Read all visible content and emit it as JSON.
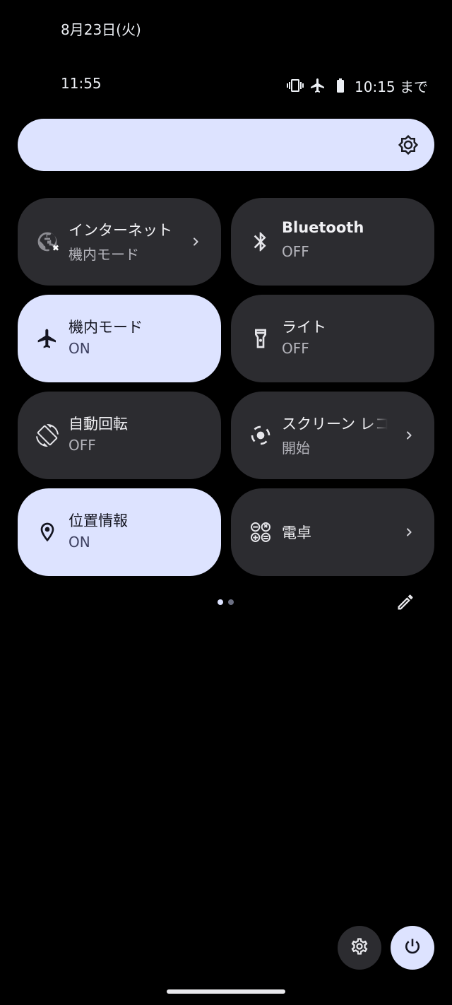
{
  "status": {
    "date": "8月23日(火)",
    "clock": "11:55",
    "battery_text": "10:15 まで",
    "icons": [
      "vibrate-icon",
      "airplane-icon",
      "battery-icon"
    ]
  },
  "brightness": {
    "icon": "brightness-icon"
  },
  "tiles": [
    {
      "label": "インターネット",
      "sub": "機内モード",
      "state": "unavailable",
      "icon": "globe-off-icon",
      "chevron": true
    },
    {
      "label": "Bluetooth",
      "sub": "OFF",
      "state": "off",
      "icon": "bluetooth-icon",
      "chevron": false
    },
    {
      "label": "機内モード",
      "sub": "ON",
      "state": "on",
      "icon": "airplane-icon",
      "chevron": false
    },
    {
      "label": "ライト",
      "sub": "OFF",
      "state": "off",
      "icon": "flashlight-icon",
      "chevron": false
    },
    {
      "label": "自動回転",
      "sub": "OFF",
      "state": "off",
      "icon": "auto-rotate-icon",
      "chevron": false
    },
    {
      "label": "スクリーン レコード",
      "sub": "開始",
      "state": "off",
      "icon": "screen-record-icon",
      "chevron": true
    },
    {
      "label": "位置情報",
      "sub": "ON",
      "state": "on",
      "icon": "location-icon",
      "chevron": false
    },
    {
      "label": "電卓",
      "sub": "",
      "state": "off",
      "icon": "calculator-icon",
      "chevron": true
    }
  ],
  "pager": {
    "pages": 2,
    "current": 1
  },
  "colors": {
    "background": "#000000",
    "tile_off": "#2c2c30",
    "tile_on": "#dde3ff",
    "text_light": "#f1f1f4",
    "text_dark": "#141520"
  }
}
